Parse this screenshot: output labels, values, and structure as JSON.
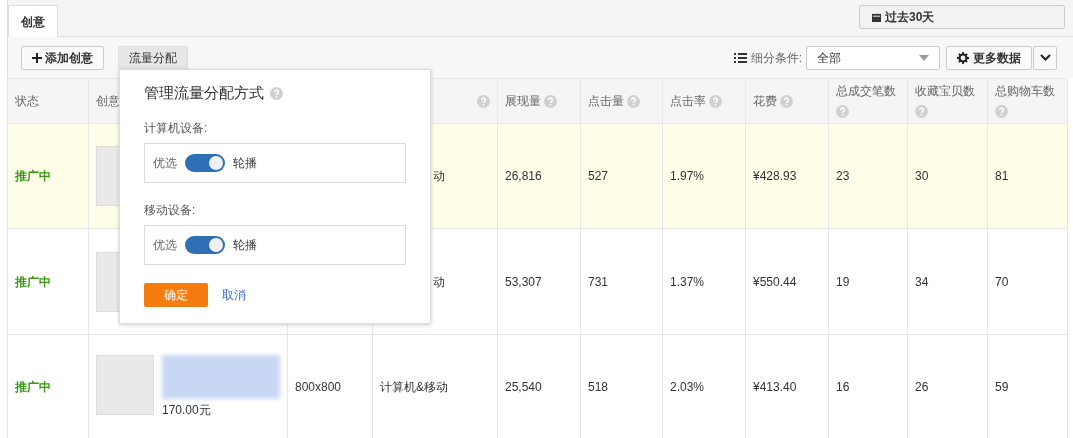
{
  "tabs": [
    {
      "label": "创意",
      "selected": true
    }
  ],
  "date_range": "过去30天",
  "toolbar": {
    "buttons": [
      {
        "label": "添加创意",
        "kind": "add",
        "selected": false
      },
      {
        "label": "流量分配",
        "kind": "plain",
        "selected": true
      }
    ],
    "filter_label": "细分条件:",
    "filter_value": "全部",
    "more_button": "更多数据"
  },
  "table": {
    "columns": [
      {
        "label": "状态",
        "help": false
      },
      {
        "label": "创意"
      },
      {},
      {
        "help": true
      },
      {
        "label": "展现量",
        "help": true
      },
      {
        "label": "点击量",
        "help": true
      },
      {
        "label": "点击率",
        "help": true
      },
      {
        "label": "花费",
        "help": true
      },
      {
        "label": "总成交笔数",
        "help": true
      },
      {
        "label": "收藏宝贝数",
        "help": true
      },
      {
        "label": "总购物车数",
        "help": true
      }
    ],
    "rows": [
      {
        "highlighted": true,
        "covered": true,
        "status": "推广中",
        "device": "动",
        "impressions": "26,816",
        "clicks": "527",
        "ctr": "1.97%",
        "cost": "¥428.93",
        "orders": "23",
        "favorites": "30",
        "carts": "81"
      },
      {
        "highlighted": false,
        "covered": true,
        "status": "推广中",
        "device": "动",
        "impressions": "53,307",
        "clicks": "731",
        "ctr": "1.37%",
        "cost": "¥550.44",
        "orders": "19",
        "favorites": "34",
        "carts": "70"
      },
      {
        "highlighted": false,
        "covered": false,
        "status": "推广中",
        "price": "170.00元",
        "size": "800x800",
        "device": "计算机&移动",
        "impressions": "25,540",
        "clicks": "518",
        "ctr": "2.03%",
        "cost": "¥413.40",
        "orders": "16",
        "favorites": "26",
        "carts": "59"
      }
    ]
  },
  "popup": {
    "title": "管理流量分配方式",
    "groups": [
      {
        "label": "计算机设备:",
        "left": "优选",
        "right": "轮播",
        "on": true
      },
      {
        "label": "移动设备:",
        "left": "优选",
        "right": "轮播",
        "on": true
      }
    ],
    "confirm": "确定",
    "cancel": "取消"
  }
}
